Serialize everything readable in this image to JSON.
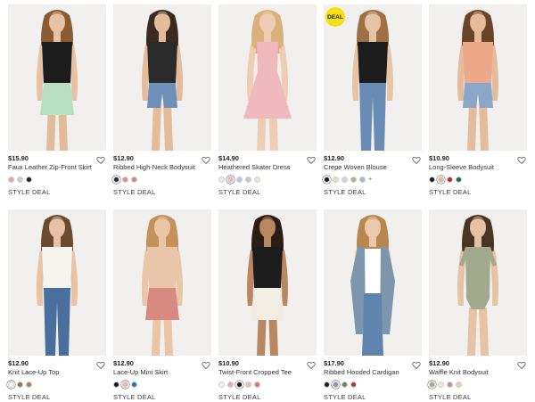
{
  "products": [
    {
      "price": "$15.90",
      "title": "Faux Leather Zip-Front Skirt",
      "deal": "STYLE DEAL",
      "badge": "",
      "selected": -1,
      "more": "",
      "swatches": [
        "#e9a6a0",
        "#c9cfc6",
        "#222222"
      ],
      "skin": "#e7c2a4",
      "hair": "#8a5a33",
      "top": "#1c1c1c",
      "bottom": "#b7e0c3",
      "legs": "#e2bb9b",
      "bottom_type": "skirt"
    },
    {
      "price": "$12.90",
      "title": "Ribbed High-Neck Bodysuit",
      "deal": "STYLE DEAL",
      "badge": "",
      "selected": 0,
      "more": "",
      "swatches": [
        "#2a2a2a",
        "#e58d8d",
        "#c9868c"
      ],
      "skin": "#e4bc9b",
      "hair": "#3b2a20",
      "top": "#2a2a2a",
      "bottom": "#6d8fb8",
      "legs": "#e4bc9b",
      "bottom_type": "shorts"
    },
    {
      "price": "$14.90",
      "title": "Heathered Skater Dress",
      "deal": "STYLE DEAL",
      "badge": "",
      "selected": 1,
      "more": "",
      "swatches": [
        "#efeae6",
        "#f0b9be",
        "#b9c2ea",
        "#c9c8c0",
        "#efe5c9"
      ],
      "skin": "#efcdb4",
      "hair": "#d8b27a",
      "top": "#f0b9be",
      "bottom": "#f0b9be",
      "legs": "#efcdb4",
      "bottom_type": "dress"
    },
    {
      "price": "$12.90",
      "title": "Crepe Woven Blouse",
      "deal": "STYLE DEAL",
      "badge": "DEAL",
      "selected": 0,
      "more": "+",
      "swatches": [
        "#1c1c1c",
        "#efd6cf",
        "#d2d2d2",
        "#a8b39a",
        "#a7b7d3"
      ],
      "skin": "#e8c4a6",
      "hair": "#a07045",
      "top": "#1c1c1c",
      "bottom": "#6a8cb4",
      "legs": "#e8c4a6",
      "bottom_type": "jeans"
    },
    {
      "price": "$10.90",
      "title": "Long-Sleeve Bodysuit",
      "deal": "STYLE DEAL",
      "badge": "",
      "selected": 1,
      "more": "",
      "swatches": [
        "#1c1c1c",
        "#e7b796",
        "#c0272d",
        "#1f6b5f"
      ],
      "skin": "#e4bc9b",
      "hair": "#6a4428",
      "top": "#eda88a",
      "bottom": "#8aa6c9",
      "legs": "#e4bc9b",
      "bottom_type": "shorts"
    },
    {
      "price": "$12.90",
      "title": "Knit Lace-Up Top",
      "deal": "STYLE DEAL",
      "badge": "",
      "selected": 0,
      "more": "",
      "swatches": [
        "#f4f4f2",
        "#8a8040",
        "#c4705a"
      ],
      "skin": "#e7c2a4",
      "hair": "#6b4a2e",
      "top": "#f5f4ef",
      "bottom": "#4a6f9e",
      "legs": "#4a6f9e",
      "bottom_type": "jeans"
    },
    {
      "price": "$12.90",
      "title": "Lace-Up Mini Skirt",
      "deal": "STYLE DEAL",
      "badge": "",
      "selected": 1,
      "more": "",
      "swatches": [
        "#1c1c1c",
        "#f2b8ad",
        "#1f6fc8"
      ],
      "skin": "#eac5a6",
      "hair": "#c2915c",
      "top": "#e9c6a9",
      "bottom": "#d98a80",
      "legs": "#eac5a6",
      "bottom_type": "skirt"
    },
    {
      "price": "$10.90",
      "title": "Twist-Front Cropped Tee",
      "deal": "STYLE DEAL",
      "badge": "",
      "selected": 2,
      "more": "",
      "swatches": [
        "#f3f3f3",
        "#f0a89e",
        "#1c1c1c",
        "#f2b8b0",
        "#e8725f"
      ],
      "skin": "#b98762",
      "hair": "#2a1d15",
      "top": "#1c1c1c",
      "bottom": "#f2eee4",
      "legs": "#b98762",
      "bottom_type": "skirt"
    },
    {
      "price": "$17.90",
      "title": "Ribbed Hooded Cardigan",
      "deal": "STYLE DEAL",
      "badge": "",
      "selected": 1,
      "more": "",
      "swatches": [
        "#1c1c1c",
        "#7f97b0",
        "#7c7f4a",
        "#b23a34"
      ],
      "skin": "#ecc9ac",
      "hair": "#b8874f",
      "top": "#7c97ad",
      "bottom": "#5f84ad",
      "legs": "#5f84ad",
      "bottom_type": "cardigan"
    },
    {
      "price": "$12.90",
      "title": "Waffle Knit Bodysuit",
      "deal": "STYLE DEAL",
      "badge": "",
      "selected": 0,
      "more": "",
      "swatches": [
        "#a2aa8d",
        "#f1e6dc",
        "#c49486",
        "#f1c8b0"
      ],
      "skin": "#e7c2a4",
      "hair": "#4a3424",
      "top": "#a2aa8d",
      "bottom": "#a2aa8d",
      "legs": "#e7c2a4",
      "bottom_type": "bodysuit"
    }
  ]
}
